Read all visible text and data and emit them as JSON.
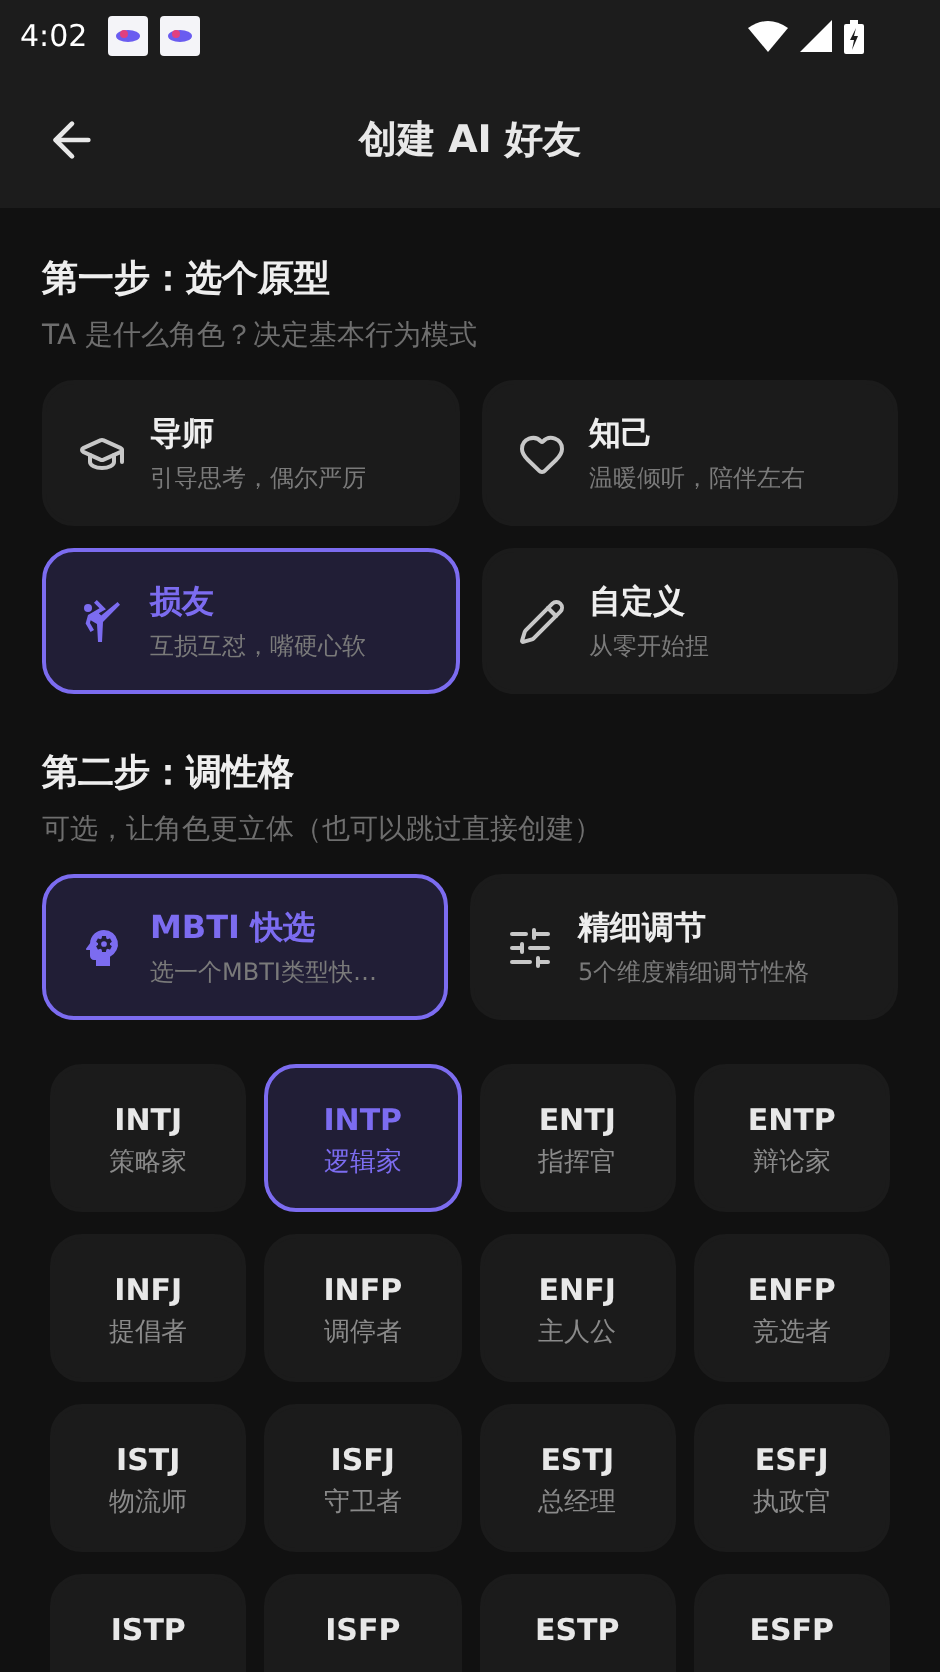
{
  "status_bar": {
    "time": "4:02"
  },
  "header": {
    "title": "创建 AI 好友"
  },
  "step1": {
    "title": "第一步：选个原型",
    "subtitle": "TA 是什么角色？决定基本行为模式",
    "options": [
      {
        "kind": "mentor",
        "title": "导师",
        "desc": "引导思考，偶尔严厉",
        "selected": false
      },
      {
        "kind": "friend",
        "title": "知己",
        "desc": "温暖倾听，陪伴左右",
        "selected": false
      },
      {
        "kind": "buddy",
        "title": "损友",
        "desc": "互损互怼，嘴硬心软",
        "selected": true
      },
      {
        "kind": "custom",
        "title": "自定义",
        "desc": "从零开始捏",
        "selected": false
      }
    ]
  },
  "step2": {
    "title": "第二步：调性格",
    "subtitle": "可选，让角色更立体（也可以跳过直接创建）",
    "modes": [
      {
        "kind": "mbti",
        "title": "MBTI 快选",
        "desc": "选一个MBTI类型快…",
        "selected": true
      },
      {
        "kind": "fine",
        "title": "精细调节",
        "desc": "5个维度精细调节性格",
        "selected": false
      }
    ],
    "types": [
      {
        "code": "INTJ",
        "name": "策略家",
        "selected": false
      },
      {
        "code": "INTP",
        "name": "逻辑家",
        "selected": true
      },
      {
        "code": "ENTJ",
        "name": "指挥官",
        "selected": false
      },
      {
        "code": "ENTP",
        "name": "辩论家",
        "selected": false
      },
      {
        "code": "INFJ",
        "name": "提倡者",
        "selected": false
      },
      {
        "code": "INFP",
        "name": "调停者",
        "selected": false
      },
      {
        "code": "ENFJ",
        "name": "主人公",
        "selected": false
      },
      {
        "code": "ENFP",
        "name": "竞选者",
        "selected": false
      },
      {
        "code": "ISTJ",
        "name": "物流师",
        "selected": false
      },
      {
        "code": "ISFJ",
        "name": "守卫者",
        "selected": false
      },
      {
        "code": "ESTJ",
        "name": "总经理",
        "selected": false
      },
      {
        "code": "ESFJ",
        "name": "执政官",
        "selected": false
      },
      {
        "code": "ISTP",
        "selected": false
      },
      {
        "code": "ISFP",
        "selected": false
      },
      {
        "code": "ESTP",
        "selected": false
      },
      {
        "code": "ESFP",
        "selected": false
      }
    ]
  }
}
